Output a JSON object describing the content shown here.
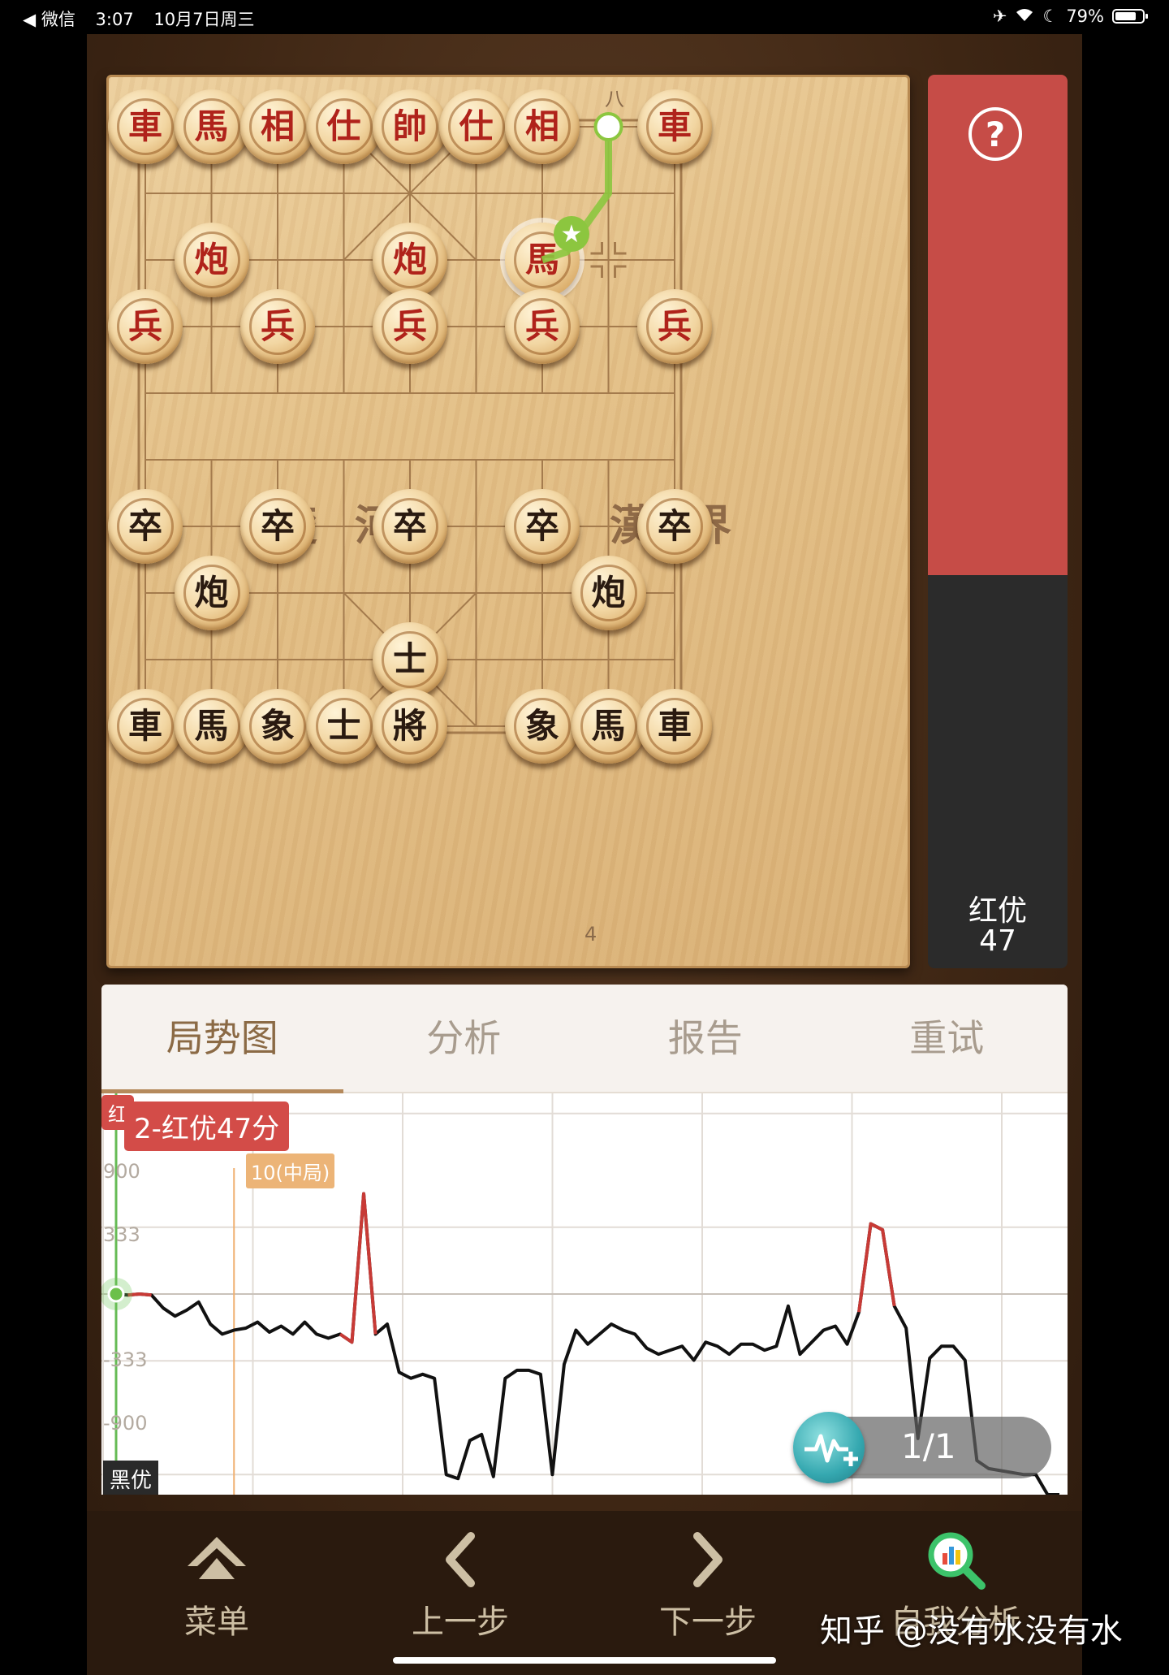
{
  "status_bar": {
    "back_app": "◀ 微信",
    "time": "3:07",
    "date": "10月7日周三",
    "battery": "79%",
    "battery_level": 0.79,
    "icons": [
      "airplane-icon",
      "wifi-icon",
      "moon-icon",
      "battery-icon"
    ]
  },
  "board": {
    "river_left": "楚 河",
    "river_right": "漢 界",
    "top_file_label": "八",
    "bottom_file_label": "4",
    "pieces": [
      {
        "ch": "車",
        "side": "red",
        "file": 0,
        "rank": 0
      },
      {
        "ch": "馬",
        "side": "red",
        "file": 1,
        "rank": 0
      },
      {
        "ch": "相",
        "side": "red",
        "file": 2,
        "rank": 0
      },
      {
        "ch": "仕",
        "side": "red",
        "file": 3,
        "rank": 0
      },
      {
        "ch": "帥",
        "side": "red",
        "file": 4,
        "rank": 0
      },
      {
        "ch": "仕",
        "side": "red",
        "file": 5,
        "rank": 0
      },
      {
        "ch": "相",
        "side": "red",
        "file": 6,
        "rank": 0
      },
      {
        "ch": "車",
        "side": "red",
        "file": 8,
        "rank": 0
      },
      {
        "ch": "炮",
        "side": "red",
        "file": 1,
        "rank": 2
      },
      {
        "ch": "炮",
        "side": "red",
        "file": 4,
        "rank": 2
      },
      {
        "ch": "馬",
        "side": "red",
        "file": 6,
        "rank": 2,
        "selected": true
      },
      {
        "ch": "兵",
        "side": "red",
        "file": 0,
        "rank": 3
      },
      {
        "ch": "兵",
        "side": "red",
        "file": 2,
        "rank": 3
      },
      {
        "ch": "兵",
        "side": "red",
        "file": 4,
        "rank": 3
      },
      {
        "ch": "兵",
        "side": "red",
        "file": 6,
        "rank": 3
      },
      {
        "ch": "兵",
        "side": "red",
        "file": 8,
        "rank": 3
      },
      {
        "ch": "卒",
        "side": "black",
        "file": 0,
        "rank": 6
      },
      {
        "ch": "卒",
        "side": "black",
        "file": 2,
        "rank": 6
      },
      {
        "ch": "卒",
        "side": "black",
        "file": 4,
        "rank": 6
      },
      {
        "ch": "卒",
        "side": "black",
        "file": 6,
        "rank": 6
      },
      {
        "ch": "卒",
        "side": "black",
        "file": 8,
        "rank": 6
      },
      {
        "ch": "炮",
        "side": "black",
        "file": 1,
        "rank": 7
      },
      {
        "ch": "炮",
        "side": "black",
        "file": 7,
        "rank": 7
      },
      {
        "ch": "士",
        "side": "black",
        "file": 4,
        "rank": 8
      },
      {
        "ch": "車",
        "side": "black",
        "file": 0,
        "rank": 9
      },
      {
        "ch": "馬",
        "side": "black",
        "file": 1,
        "rank": 9
      },
      {
        "ch": "象",
        "side": "black",
        "file": 2,
        "rank": 9
      },
      {
        "ch": "士",
        "side": "black",
        "file": 3,
        "rank": 9
      },
      {
        "ch": "將",
        "side": "black",
        "file": 4,
        "rank": 9
      },
      {
        "ch": "象",
        "side": "black",
        "file": 6,
        "rank": 9
      },
      {
        "ch": "馬",
        "side": "black",
        "file": 7,
        "rank": 9
      },
      {
        "ch": "車",
        "side": "black",
        "file": 8,
        "rank": 9
      }
    ],
    "last_move": {
      "from": {
        "file": 7,
        "rank": 0
      },
      "to": {
        "file": 6,
        "rank": 2
      }
    }
  },
  "eval_bar": {
    "help_label": "?",
    "red_share": 0.56,
    "label_line1": "红优",
    "label_line2": "47"
  },
  "tabs": [
    {
      "label": "局势图",
      "active": true
    },
    {
      "label": "分析",
      "active": false
    },
    {
      "label": "报告",
      "active": false
    },
    {
      "label": "重试",
      "active": false
    }
  ],
  "chart_data": {
    "type": "line",
    "current_badge": "2-红优47分",
    "phase_marker": {
      "label": "10(中局)",
      "x": 10
    },
    "top_label": "红",
    "bottom_label": "黑优",
    "yticks": [
      900,
      333,
      -333,
      -900
    ],
    "ytick_labels": [
      "900",
      "333",
      "-333",
      "-900"
    ],
    "ylim": [
      -1000,
      1000
    ],
    "xlim": [
      0,
      80
    ],
    "current_x": 0,
    "x": [
      0,
      1,
      2,
      3,
      4,
      5,
      6,
      7,
      8,
      9,
      10,
      11,
      12,
      13,
      14,
      15,
      16,
      17,
      18,
      19,
      20,
      21,
      22,
      23,
      24,
      25,
      26,
      27,
      28,
      29,
      30,
      31,
      32,
      33,
      34,
      35,
      36,
      37,
      38,
      39,
      40,
      41,
      42,
      43,
      44,
      45,
      46,
      47,
      48,
      49,
      50,
      51,
      52,
      53,
      54,
      55,
      56,
      57,
      58,
      59,
      60,
      61,
      62,
      63,
      64,
      65,
      66,
      67,
      68,
      69,
      70,
      71,
      72,
      73,
      74,
      75,
      76,
      77,
      78,
      79,
      80
    ],
    "values": [
      0,
      -5,
      0,
      -5,
      -70,
      -110,
      -80,
      -40,
      -150,
      -200,
      -180,
      -170,
      -140,
      -190,
      -160,
      -200,
      -140,
      -200,
      -220,
      -200,
      -240,
      500,
      -200,
      -150,
      -390,
      -420,
      -400,
      -420,
      -900,
      -920,
      -730,
      -700,
      -910,
      -420,
      -380,
      -380,
      -400,
      -900,
      -350,
      -180,
      -250,
      -200,
      -150,
      -180,
      -200,
      -270,
      -300,
      -280,
      -260,
      -330,
      -240,
      -260,
      -300,
      -250,
      -250,
      -280,
      -260,
      -60,
      -300,
      -240,
      -180,
      -160,
      -250,
      -90,
      350,
      320,
      -60,
      -170,
      -720,
      -320,
      -260,
      -260,
      -330,
      -830,
      -870,
      -880,
      -890,
      -900,
      -900,
      -1050,
      -1100
    ],
    "red_segments": [
      [
        1,
        3
      ],
      [
        19,
        22
      ],
      [
        63,
        66
      ]
    ],
    "pager": "1/1"
  },
  "bottom_nav": [
    {
      "label": "菜单",
      "icon": "menu-up-icon"
    },
    {
      "label": "上一步",
      "icon": "chevron-left-icon"
    },
    {
      "label": "下一步",
      "icon": "chevron-right-icon"
    },
    {
      "label": "自我分析",
      "icon": "analysis-magnifier-icon"
    }
  ],
  "watermark": "知乎 @没有水没有水",
  "colors": {
    "red_piece": "#b0231b",
    "black_piece": "#2a1a10",
    "eval_red": "#c64c47",
    "eval_black": "#2b2b2b",
    "move_arrow": "#8cc63f",
    "chart_red": "#c83a36",
    "chart_black": "#111111"
  }
}
